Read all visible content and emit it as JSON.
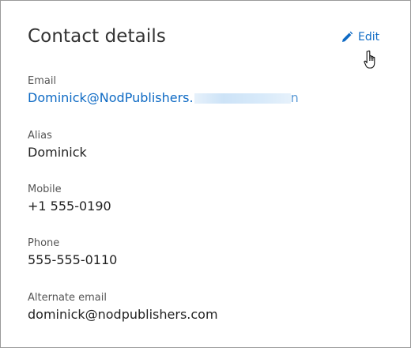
{
  "card": {
    "title": "Contact details",
    "edit_label": "Edit"
  },
  "fields": [
    {
      "label": "Email",
      "value_visible": "Dominick@NodPublishers.",
      "value_tail": "n"
    },
    {
      "label": "Alias",
      "value": "Dominick"
    },
    {
      "label": "Mobile",
      "value": "+1 555-0190"
    },
    {
      "label": "Phone",
      "value": "555-555-0110"
    },
    {
      "label": "Alternate email",
      "value": "dominick@nodpublishers.com"
    }
  ],
  "icons": {
    "edit": "pencil-icon",
    "cursor": "hand-pointer-icon"
  },
  "colors": {
    "accent": "#0e6ac4",
    "title": "#333333",
    "label": "#555555",
    "value": "#222222",
    "border": "#9a9a9a"
  }
}
